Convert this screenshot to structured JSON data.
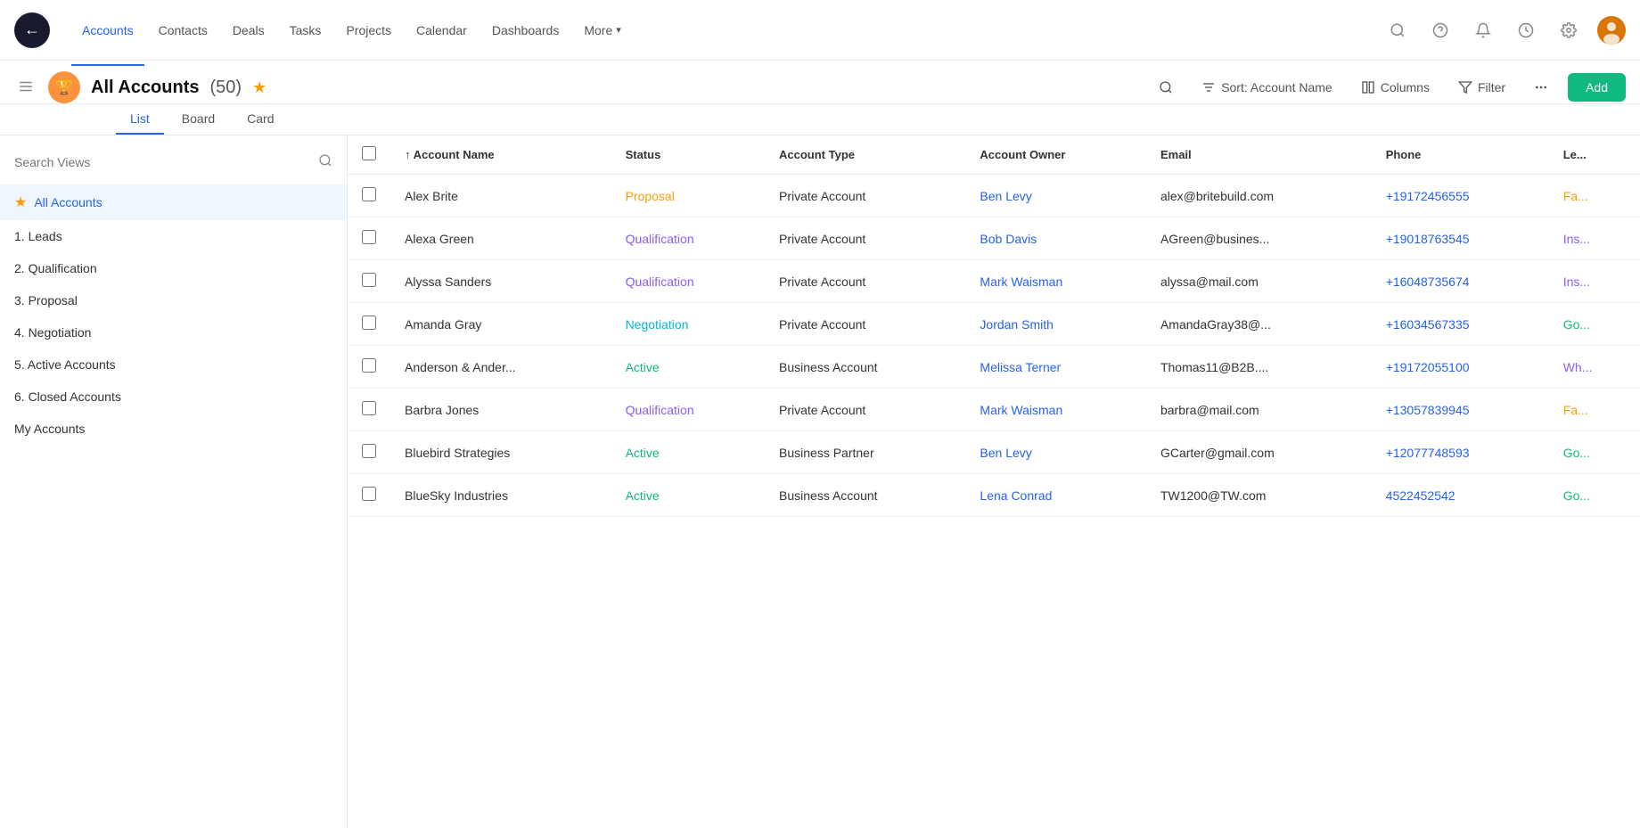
{
  "nav": {
    "logo": "←",
    "links": [
      {
        "label": "Accounts",
        "active": true
      },
      {
        "label": "Contacts",
        "active": false
      },
      {
        "label": "Deals",
        "active": false
      },
      {
        "label": "Tasks",
        "active": false
      },
      {
        "label": "Projects",
        "active": false
      },
      {
        "label": "Calendar",
        "active": false
      },
      {
        "label": "Dashboards",
        "active": false
      }
    ],
    "more_label": "More",
    "more_chevron": "▾",
    "icons": {
      "search": "⌕",
      "help": "?",
      "bell": "🔔",
      "history": "🕐",
      "settings": "⚙"
    }
  },
  "subheader": {
    "title": "All Accounts",
    "count": "(50)",
    "tabs": [
      {
        "label": "List",
        "active": true
      },
      {
        "label": "Board",
        "active": false
      },
      {
        "label": "Card",
        "active": false
      }
    ],
    "sort_label": "Sort: Account Name",
    "columns_label": "Columns",
    "filter_label": "Filter",
    "add_label": "Add"
  },
  "sidebar": {
    "search_placeholder": "Search Views",
    "items": [
      {
        "label": "All Accounts",
        "active": true,
        "star": true
      },
      {
        "label": "1. Leads",
        "active": false
      },
      {
        "label": "2. Qualification",
        "active": false
      },
      {
        "label": "3. Proposal",
        "active": false
      },
      {
        "label": "4. Negotiation",
        "active": false
      },
      {
        "label": "5. Active Accounts",
        "active": false
      },
      {
        "label": "6. Closed Accounts",
        "active": false
      },
      {
        "label": "My Accounts",
        "active": false
      }
    ]
  },
  "table": {
    "columns": [
      {
        "key": "account_name",
        "label": "Account Name",
        "sortable": true,
        "sort_dir": "asc"
      },
      {
        "key": "status",
        "label": "Status"
      },
      {
        "key": "account_type",
        "label": "Account Type"
      },
      {
        "key": "account_owner",
        "label": "Account Owner"
      },
      {
        "key": "email",
        "label": "Email"
      },
      {
        "key": "phone",
        "label": "Phone"
      },
      {
        "key": "lead",
        "label": "Le..."
      }
    ],
    "rows": [
      {
        "account_name": "Alex Brite",
        "status": "Proposal",
        "status_class": "status-proposal",
        "account_type": "Private Account",
        "account_owner": "Ben Levy",
        "email": "alex@britebuild.com",
        "phone": "+19172456555",
        "lead": "Fa..."
      },
      {
        "account_name": "Alexa Green",
        "status": "Qualification",
        "status_class": "status-qualification",
        "account_type": "Private Account",
        "account_owner": "Bob Davis",
        "email": "AGreen@busines...",
        "phone": "+19018763545",
        "lead": "Ins..."
      },
      {
        "account_name": "Alyssa Sanders",
        "status": "Qualification",
        "status_class": "status-qualification",
        "account_type": "Private Account",
        "account_owner": "Mark Waisman",
        "email": "alyssa@mail.com",
        "phone": "+16048735674",
        "lead": "Ins..."
      },
      {
        "account_name": "Amanda Gray",
        "status": "Negotiation",
        "status_class": "status-negotiation",
        "account_type": "Private Account",
        "account_owner": "Jordan Smith",
        "email": "AmandaGray38@...",
        "phone": "+16034567335",
        "lead": "Go..."
      },
      {
        "account_name": "Anderson & Ander...",
        "status": "Active",
        "status_class": "status-active",
        "account_type": "Business Account",
        "account_owner": "Melissa Terner",
        "email": "Thomas11@B2B....",
        "phone": "+19172055100",
        "lead": "Wh..."
      },
      {
        "account_name": "Barbra Jones",
        "status": "Qualification",
        "status_class": "status-qualification",
        "account_type": "Private Account",
        "account_owner": "Mark Waisman",
        "email": "barbra@mail.com",
        "phone": "+13057839945",
        "lead": "Fa..."
      },
      {
        "account_name": "Bluebird Strategies",
        "status": "Active",
        "status_class": "status-active",
        "account_type": "Business Partner",
        "account_owner": "Ben Levy",
        "email": "GCarter@gmail.com",
        "phone": "+12077748593",
        "lead": "Go..."
      },
      {
        "account_name": "BlueSky Industries",
        "status": "Active",
        "status_class": "status-active",
        "account_type": "Business Account",
        "account_owner": "Lena Conrad",
        "email": "TW1200@TW.com",
        "phone": "4522452542",
        "lead": "Go..."
      }
    ]
  }
}
